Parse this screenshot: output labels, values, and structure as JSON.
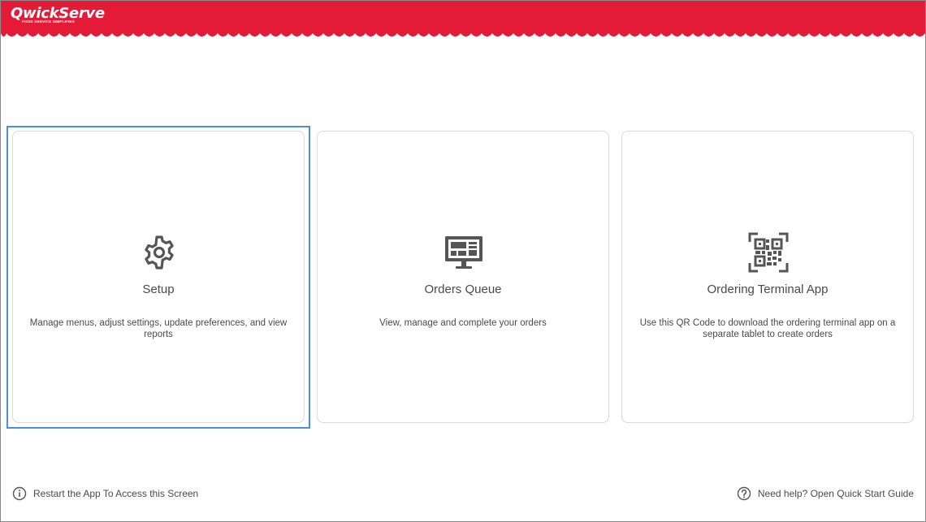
{
  "app": {
    "logo_name": "QwickServe",
    "logo_tagline": "Food Service Simplified",
    "brand_color": "#e31b37"
  },
  "cards": [
    {
      "title": "Setup",
      "description": "Manage menus, adjust settings, update preferences, and view reports",
      "icon": "gear-icon"
    },
    {
      "title": "Orders Queue",
      "description": "View, manage and complete your orders",
      "icon": "monitor-icon"
    },
    {
      "title": "Ordering Terminal App",
      "description": "Use this QR Code to download the ordering terminal app on a separate tablet to create orders",
      "icon": "qr-code-icon"
    }
  ],
  "footer": {
    "restart_text": "Restart the App To Access this Screen",
    "help_text": "Need help? Open Quick Start Guide"
  },
  "colors": {
    "focus_ring": "#4a90d9",
    "card_border": "#d9d9d9",
    "text": "#4a4a4a"
  }
}
